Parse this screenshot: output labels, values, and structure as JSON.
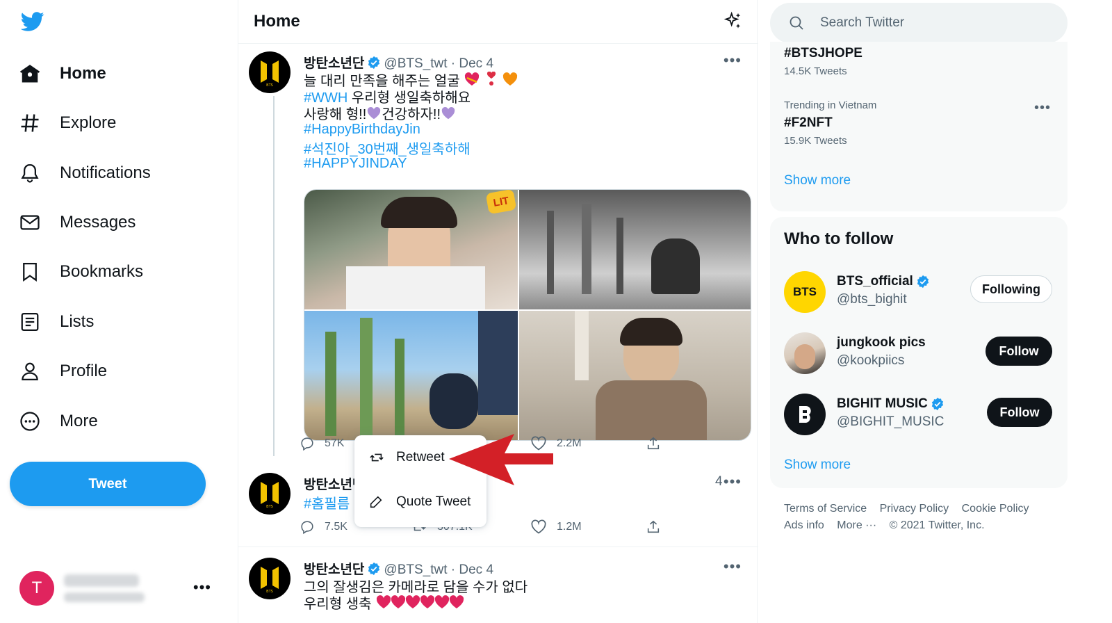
{
  "sidebar": {
    "items": [
      {
        "label": "Home",
        "icon": "home-icon",
        "active": true
      },
      {
        "label": "Explore",
        "icon": "hashtag-icon"
      },
      {
        "label": "Notifications",
        "icon": "bell-icon"
      },
      {
        "label": "Messages",
        "icon": "envelope-icon"
      },
      {
        "label": "Bookmarks",
        "icon": "bookmark-icon"
      },
      {
        "label": "Lists",
        "icon": "list-icon"
      },
      {
        "label": "Profile",
        "icon": "person-icon"
      },
      {
        "label": "More",
        "icon": "more-circle-icon"
      }
    ],
    "tweet_button": "Tweet",
    "account": {
      "avatar_letter": "T"
    }
  },
  "main": {
    "title": "Home",
    "tweets": [
      {
        "name": "방탄소년단",
        "handle": "@BTS_twt",
        "date": "Dec 4",
        "lines": [
          "늘 대리 만족을 해주는 얼굴",
          "#WWH 우리형 생일축하해요",
          "사랑해 형!!",
          "건강하자!!",
          "#HappyBirthdayJin",
          "#석진아_30번째_생일축하해",
          "#HAPPYJINDAY"
        ],
        "line2_link": "#WWH",
        "line2_rest": " 우리형 생일축하해요",
        "replies": "57K",
        "likes": "2.2M"
      },
      {
        "name": "방탄소년단",
        "date_fragment": "4",
        "hashtag": "#홈필름",
        "replies": "7.5K",
        "retweets": "307.1K",
        "likes": "1.2M"
      },
      {
        "name": "방탄소년단",
        "handle": "@BTS_twt",
        "date": "Dec 4",
        "line1": "그의 잘생김은 카메라로 담을 수가 없다",
        "line2": "우리형 생축"
      }
    ],
    "retweet_menu": {
      "retweet": "Retweet",
      "quote": "Quote Tweet"
    },
    "sticker_text": "LIT"
  },
  "right": {
    "search_placeholder": "Search Twitter",
    "trends": [
      {
        "name": "#BTSJHOPE",
        "count": "14.5K Tweets"
      },
      {
        "context": "Trending in Vietnam",
        "name": "#F2NFT",
        "count": "15.9K Tweets"
      }
    ],
    "trends_show_more": "Show more",
    "who_to_follow": {
      "title": "Who to follow",
      "accounts": [
        {
          "name": "BTS_official",
          "handle": "@bts_bighit",
          "verified": true,
          "button": "Following",
          "avatar_text": "BTS"
        },
        {
          "name": "jungkook pics",
          "handle": "@kookpiics",
          "verified": false,
          "button": "Follow"
        },
        {
          "name": "BIGHIT MUSIC",
          "handle": "@BIGHIT_MUSIC",
          "verified": true,
          "button": "Follow"
        }
      ],
      "show_more": "Show more"
    },
    "footer": {
      "row1": [
        "Terms of Service",
        "Privacy Policy",
        "Cookie Policy"
      ],
      "row2": [
        "Ads info",
        "More ···",
        "© 2021 Twitter, Inc."
      ]
    }
  },
  "colors": {
    "accent": "#1d9bf0",
    "text": "#0f1419",
    "secondary": "#536471",
    "annotation_arrow": "#d32027",
    "bts_yellow": "#ffd600"
  }
}
